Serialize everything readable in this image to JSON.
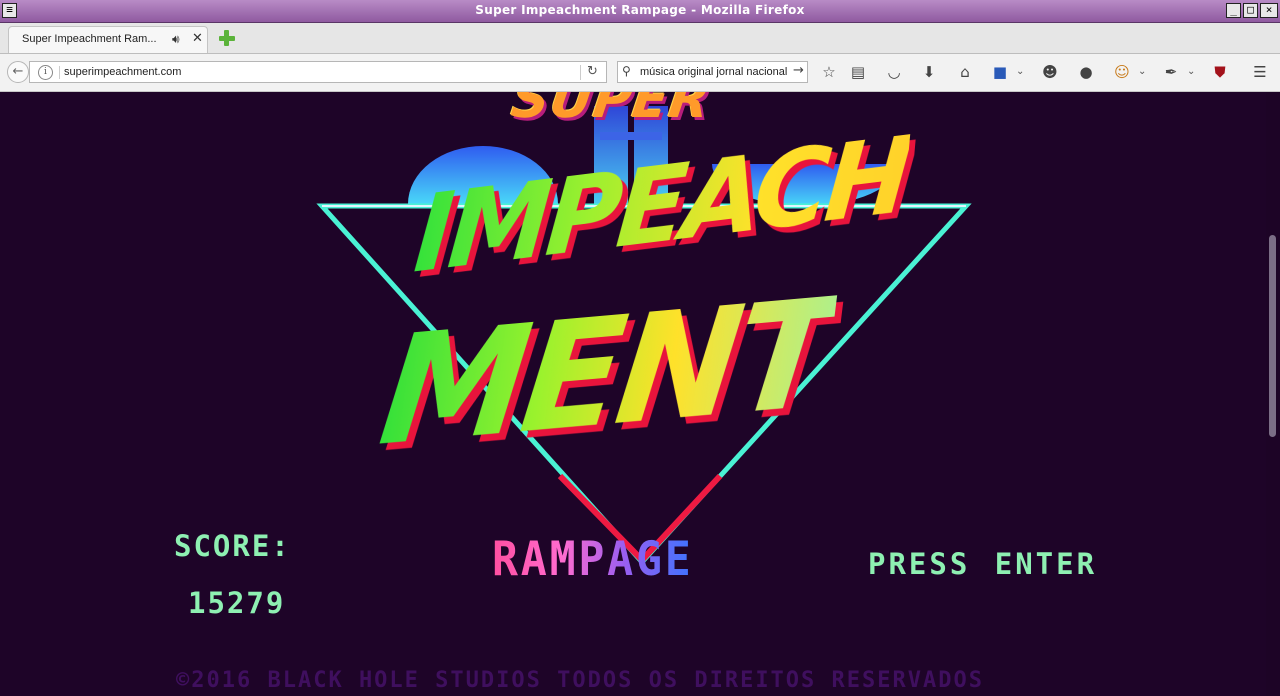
{
  "window": {
    "title": "Super Impeachment Rampage - Mozilla Firefox"
  },
  "tab": {
    "label": "Super Impeachment Ram...",
    "sound_icon": "speaker-icon",
    "close_icon": "close-icon"
  },
  "nav": {
    "url": "superimpeachment.com",
    "search_value": "música original jornal nacional"
  },
  "toolbar_icons": [
    "bookmark-star-icon",
    "reading-list-icon",
    "pocket-icon",
    "download-icon",
    "home-icon",
    "extension-ps-icon",
    "chat-icon",
    "mask-icon",
    "face-addon-icon",
    "eyedropper-icon",
    "ublock-icon",
    "menu-icon"
  ],
  "game": {
    "logo_super": "SUPER",
    "logo_impeach": "IMPEACH",
    "logo_ment": "MENT",
    "logo_rampage": "RAMPAGE",
    "score_label": "SCORE:",
    "score_value": "15279",
    "prompt": "PRESS ENTER",
    "copyright": "©2016 BLACK HOLE STUDIOS TODOS OS DIREITOS RESERVADOS"
  },
  "colors": {
    "background": "#1e0428",
    "text_green": "#8ef0b2",
    "triangle": "#46f0d6",
    "shadow_red": "#e8143c"
  }
}
